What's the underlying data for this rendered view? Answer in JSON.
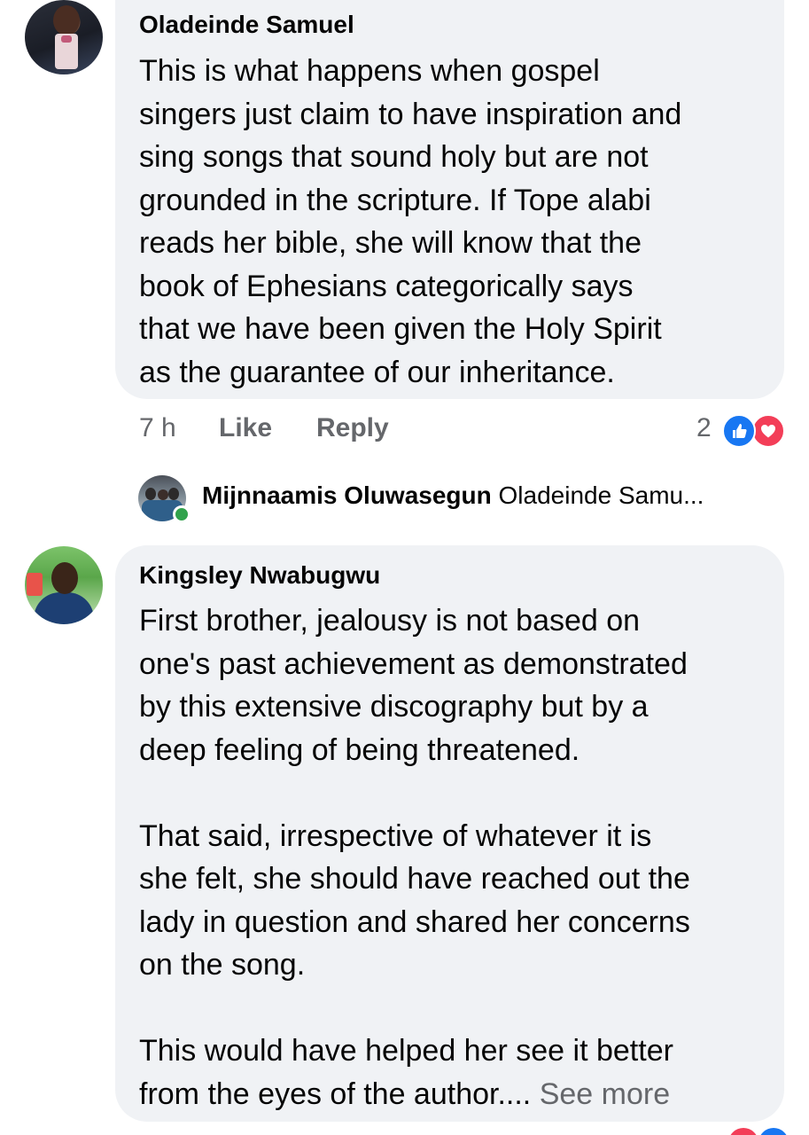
{
  "comments": [
    {
      "author": "Oladeinde Samuel",
      "lines": [
        "This is what happens when gospel",
        "singers just claim to have inspiration and",
        "sing songs that sound holy but are not",
        "grounded in the scripture. If Tope alabi",
        "reads her bible, she will know that the",
        "book of Ephesians categorically says",
        "that we have been given the Holy Spirit",
        "as the guarantee of our inheritance."
      ],
      "time": "7 h",
      "like_label": "Like",
      "reply_label": "Reply",
      "reaction_count": "2",
      "reactions": [
        "like-icon",
        "love-icon"
      ],
      "reply_preview": {
        "author": "Mijnnaamis Oluwasegun",
        "text": "Oladeinde Samu..."
      }
    },
    {
      "author": "Kingsley Nwabugwu",
      "paragraphs": [
        [
          "First brother, jealousy is not based on",
          "one's past achievement as demonstrated",
          "by this extensive discography but by a",
          "deep feeling of being threatened."
        ],
        [
          "That said, irrespective of whatever it is",
          "she felt, she should have reached out the",
          "lady in question and shared her concerns",
          "on the song."
        ],
        [
          "This would have helped her see it better"
        ]
      ],
      "last_line": "from the eyes of the author....",
      "see_more_label": "See more"
    }
  ],
  "colors": {
    "bubble": "#f0f2f5",
    "secondary_text": "#65676b",
    "like_blue": "#1877f2",
    "love_red": "#f33e58",
    "online_green": "#31a24c"
  }
}
